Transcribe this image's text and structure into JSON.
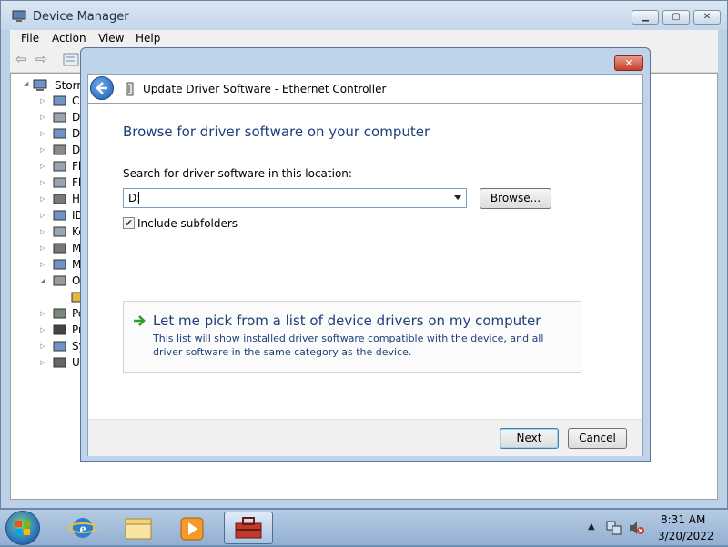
{
  "main_window": {
    "title": "Device Manager",
    "menu": [
      "File",
      "Action",
      "View",
      "Help"
    ],
    "tree": {
      "root": "Storm",
      "items": [
        {
          "label": "Co",
          "icon": "computer-icon"
        },
        {
          "label": "Di",
          "icon": "disk-drive-icon"
        },
        {
          "label": "Di",
          "icon": "display-adapter-icon"
        },
        {
          "label": "DV",
          "icon": "dvd-drive-icon"
        },
        {
          "label": "Fl",
          "icon": "floppy-controller-icon"
        },
        {
          "label": "Fl",
          "icon": "floppy-drive-icon"
        },
        {
          "label": "Hu",
          "icon": "hid-icon"
        },
        {
          "label": "ID",
          "icon": "ide-controller-icon"
        },
        {
          "label": "Ke",
          "icon": "keyboard-icon"
        },
        {
          "label": "M",
          "icon": "mouse-icon"
        },
        {
          "label": "M",
          "icon": "monitor-icon"
        },
        {
          "label": "Ot",
          "icon": "other-devices-icon"
        },
        {
          "label": "",
          "icon": "warning-device-icon"
        },
        {
          "label": "Po",
          "icon": "port-icon"
        },
        {
          "label": "Pr",
          "icon": "processor-icon"
        },
        {
          "label": "Sy",
          "icon": "system-devices-icon"
        },
        {
          "label": "Ur",
          "icon": "usb-icon"
        }
      ]
    }
  },
  "dialog": {
    "title": "Update Driver Software - Ethernet Controller",
    "heading": "Browse for driver software on your computer",
    "field_label": "Search for driver software in this location:",
    "location_value": "D:",
    "browse_label": "Browse...",
    "include_subfolders_label": "Include subfolders",
    "include_subfolders_checked": true,
    "check_glyph": "✔",
    "option_title": "Let me pick from a list of device drivers on my computer",
    "option_desc": "This list will show installed driver software compatible with the device, and all driver software in the same category as the device.",
    "next_label": "Next",
    "cancel_label": "Cancel",
    "close_glyph": "✕"
  },
  "taskbar": {
    "items": [
      "internet-explorer-icon",
      "windows-explorer-icon",
      "media-player-icon",
      "device-manager-task-icon"
    ],
    "time": "8:31 AM",
    "date": "3/20/2022"
  },
  "colors": {
    "heading_blue": "#1e3f7a",
    "option_arrow_green": "#2e9b2e",
    "close_red": "#c7402a"
  }
}
